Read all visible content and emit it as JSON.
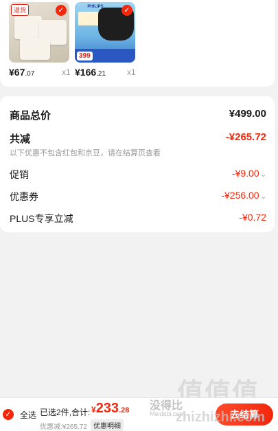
{
  "products": [
    {
      "tag": "退货",
      "price_int": "¥67",
      "price_dec": ".07",
      "qty": "x1"
    },
    {
      "brand": "PHILIPS",
      "promo_price": "399",
      "price_int": "¥166",
      "price_dec": ".21",
      "qty": "x1"
    }
  ],
  "summary": {
    "total": {
      "label": "商品总价",
      "value": "¥499.00"
    },
    "discount": {
      "label": "共减",
      "value": "-¥265.72"
    },
    "note": "以下优惠不包含红包和京豆，请在结算页查看",
    "promo": {
      "label": "促销",
      "value": "-¥9.00"
    },
    "coupon": {
      "label": "优惠券",
      "value": "-¥256.00"
    },
    "plus": {
      "label": "PLUS专享立减",
      "value": "-¥0.72"
    }
  },
  "bottom": {
    "select_all": "全选",
    "selected": "已选2件,合计:",
    "sum_yen": "¥",
    "sum_int": "233",
    "sum_dec": ".28",
    "saved": "优惠减:¥265.72",
    "details": "优惠明细",
    "checkout": "去结算"
  },
  "watermark": {
    "site_cn": "没得比",
    "site_en": "Meidebi.com",
    "big": "值值值",
    "url": "zhizhizhi.com"
  },
  "colors": {
    "accent": "#f2270c",
    "background": "#f2f2f2"
  },
  "icons": {
    "check": "check-circle-icon",
    "chevron": "chevron-down-icon"
  }
}
